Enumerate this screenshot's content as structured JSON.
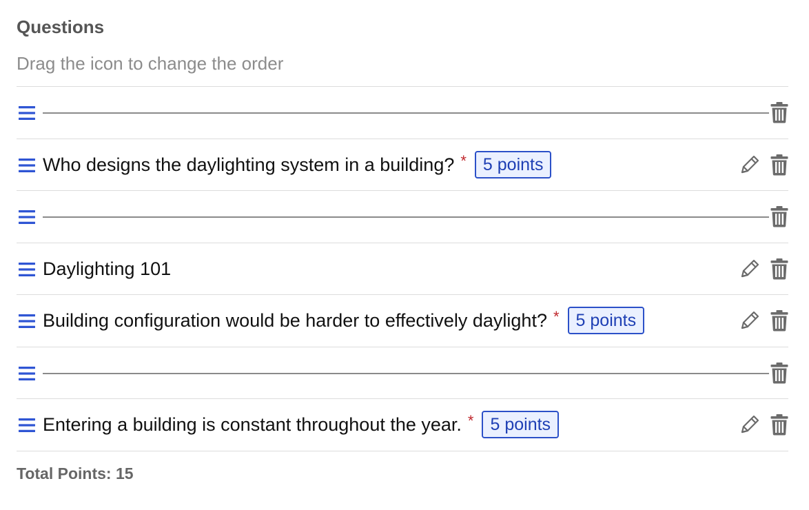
{
  "header": {
    "title": "Questions",
    "subtitle": "Drag the icon to change the order"
  },
  "icons": {
    "drag": "drag-handle-icon",
    "edit": "pencil-icon",
    "delete": "trash-icon"
  },
  "colors": {
    "drag_handle": "#2f55d4",
    "badge_border": "#2b50c8",
    "badge_text": "#1e3fb4",
    "badge_bg": "#eaf0ff",
    "required_marker": "#c0282d",
    "icon_gray": "#6b6b6b"
  },
  "items": [
    {
      "type": "divider"
    },
    {
      "type": "question",
      "text": "Who designs the daylighting system in a building?",
      "required_mark": "*",
      "points": "5 points"
    },
    {
      "type": "divider"
    },
    {
      "type": "section",
      "text": "Daylighting 101"
    },
    {
      "type": "question",
      "text": "Building configuration would be harder to effectively daylight?",
      "required_mark": "*",
      "points": "5 points"
    },
    {
      "type": "divider"
    },
    {
      "type": "question",
      "text": "Entering a building is constant throughout the year.",
      "required_mark": "*",
      "points": "5 points"
    }
  ],
  "footer": {
    "total_label": "Total Points: 15"
  }
}
